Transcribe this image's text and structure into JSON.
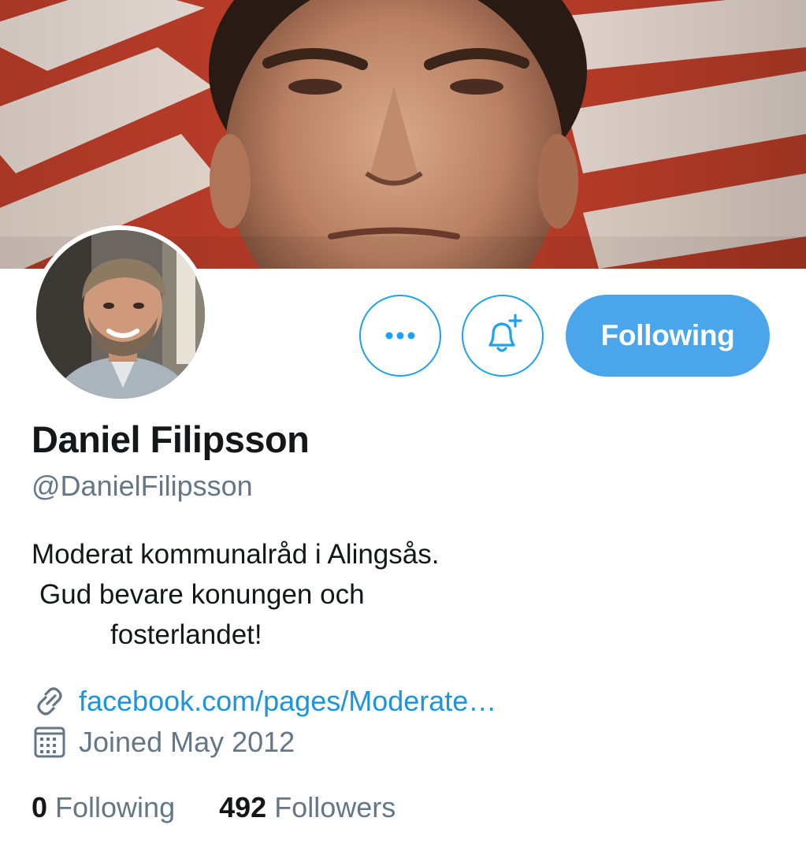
{
  "profile": {
    "name": "Daniel Filipsson",
    "handle": "@DanielFilipsson",
    "bio_lines": [
      "Moderat kommunalråd i Alingsås.",
      "Gud bevare konungen och",
      "fosterlandet!"
    ],
    "link": "facebook.com/pages/Moderate…",
    "joined": "Joined May 2012"
  },
  "actions": {
    "more_icon": "more-horizontal-icon",
    "bell_icon": "notification-bell-add-icon",
    "follow_label": "Following"
  },
  "stats": {
    "following_count": "0",
    "following_label": "Following",
    "followers_count": "492",
    "followers_label": "Followers"
  },
  "colors": {
    "accent": "#1da1f2",
    "follow_button": "#4aa5ea",
    "link": "#1b95e0",
    "secondary_text": "#657786"
  }
}
